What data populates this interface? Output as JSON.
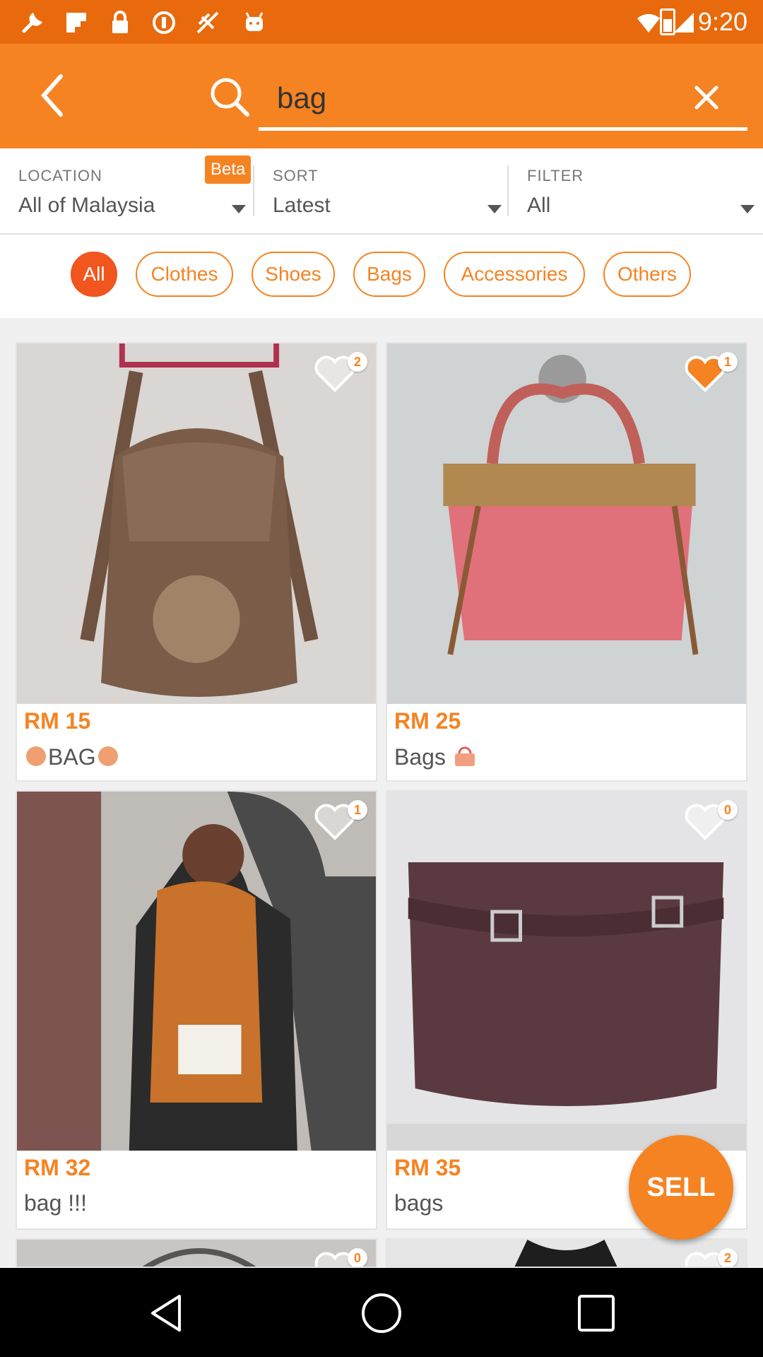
{
  "status_bar": {
    "time": "9:20"
  },
  "search": {
    "query": "bag"
  },
  "filters": {
    "location": {
      "label": "LOCATION",
      "value": "All of Malaysia",
      "badge": "Beta"
    },
    "sort": {
      "label": "SORT",
      "value": "Latest"
    },
    "filter": {
      "label": "FILTER",
      "value": "All"
    }
  },
  "categories": [
    {
      "label": "All",
      "active": true
    },
    {
      "label": "Clothes"
    },
    {
      "label": "Shoes"
    },
    {
      "label": "Bags"
    },
    {
      "label": "Accessories"
    },
    {
      "label": "Others"
    }
  ],
  "listings": [
    {
      "price": "RM 15",
      "title": "BAG",
      "likes": "2",
      "liked": false
    },
    {
      "price": "RM 25",
      "title": "Bags",
      "likes": "1",
      "liked": true
    },
    {
      "price": "RM 32",
      "title": "bag !!!",
      "likes": "1",
      "liked": false
    },
    {
      "price": "RM 35",
      "title": "bags",
      "likes": "0",
      "liked": false
    },
    {
      "likes": "0",
      "liked": false
    },
    {
      "likes": "2",
      "liked": false
    }
  ],
  "fab": {
    "label": "SELL"
  },
  "colors": {
    "accent": "#f58322",
    "status": "#e86a0c",
    "active_chip": "#f0561e"
  }
}
